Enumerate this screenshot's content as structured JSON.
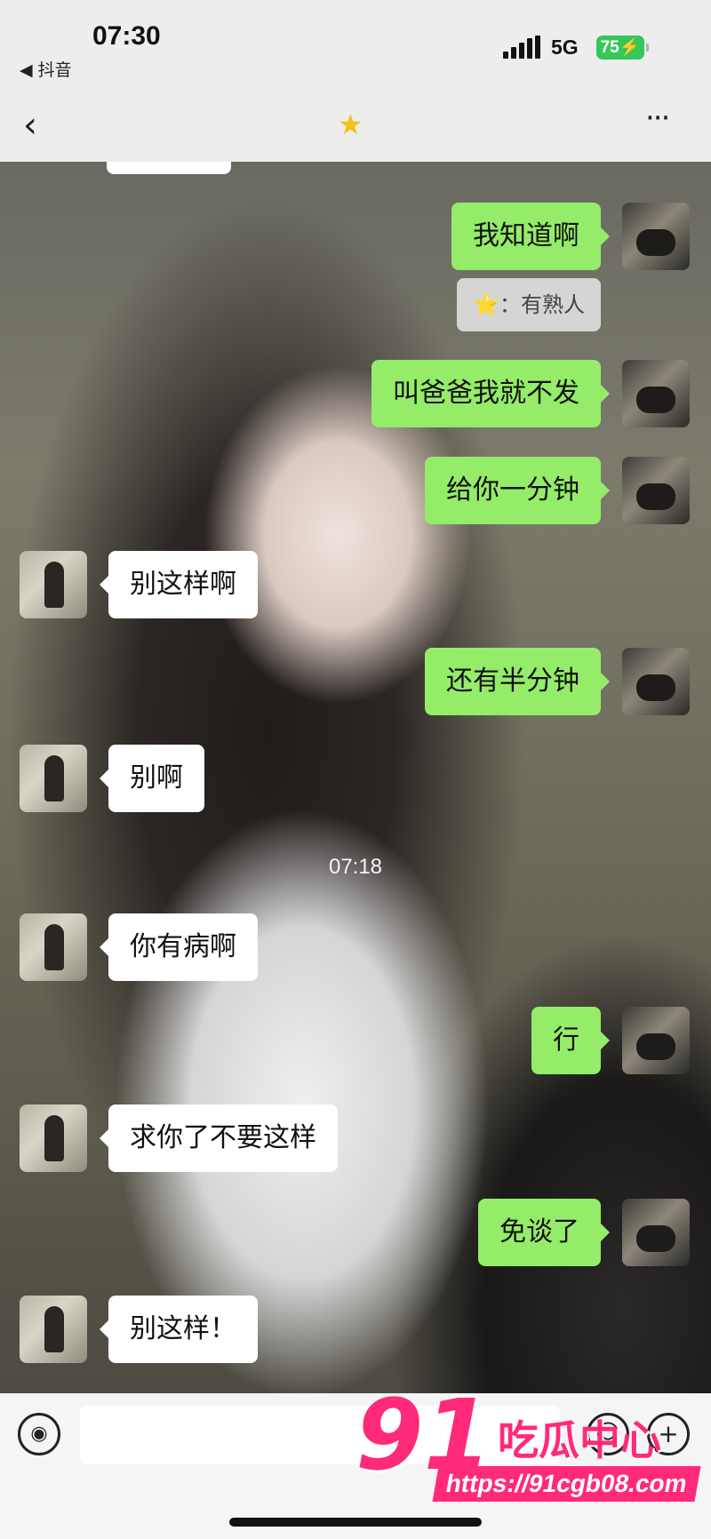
{
  "status_bar": {
    "time": "07:30",
    "back_app": "◀ 抖音",
    "network": "5G",
    "battery": "75"
  },
  "nav": {
    "back_icon": "chevron-left-icon",
    "title_icon": "star-emoji",
    "more_icon": "more-dots-icon"
  },
  "messages": [
    {
      "side": "mine",
      "text": "我知道啊"
    },
    {
      "side": "quote",
      "prefix": "⭐",
      "text": "：有熟人"
    },
    {
      "side": "mine",
      "text": "叫爸爸我就不发"
    },
    {
      "side": "mine",
      "text": "给你一分钟"
    },
    {
      "side": "other",
      "text": "别这样啊"
    },
    {
      "side": "mine",
      "text": "还有半分钟"
    },
    {
      "side": "other",
      "text": "别啊"
    },
    {
      "side": "timestamp",
      "text": "07:18"
    },
    {
      "side": "other",
      "text": "你有病啊"
    },
    {
      "side": "mine",
      "text": "行"
    },
    {
      "side": "other",
      "text": "求你了不要这样"
    },
    {
      "side": "mine",
      "text": "免谈了"
    },
    {
      "side": "other",
      "text": "别这样！"
    }
  ],
  "input": {
    "value": "",
    "voice_icon": "voice-icon",
    "emoji_icon": "emoji-icon",
    "plus_icon": "plus-icon"
  },
  "watermark": {
    "number": "91",
    "name": "吃瓜中心",
    "url": "https://91cgb08.com"
  },
  "colors": {
    "mine_bubble": "#95ec69",
    "other_bubble": "#ffffff",
    "bar_bg": "#ededed",
    "watermark": "#ff2a7a"
  }
}
